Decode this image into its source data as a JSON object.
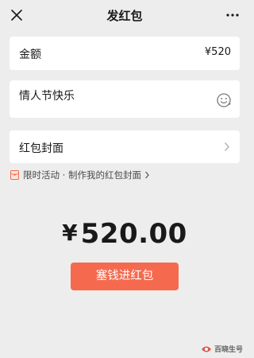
{
  "header": {
    "title": "发红包",
    "close_icon": "close-icon",
    "more_icon": "more-dots-icon"
  },
  "amount": {
    "label": "金额",
    "value": "¥520"
  },
  "message": {
    "text": "情人节快乐",
    "emoji_icon": "emoji-icon"
  },
  "cover": {
    "label": "红包封面",
    "chevron_icon": "chevron-right-icon"
  },
  "promo": {
    "text": "限时活动 · 制作我的红包封面",
    "icon": "red-envelope-icon"
  },
  "total": {
    "currency": "¥",
    "value": "520.00"
  },
  "send_button": {
    "label": "塞钱进红包",
    "color": "#f56a4f"
  },
  "watermark": {
    "text": "百晓生号"
  }
}
